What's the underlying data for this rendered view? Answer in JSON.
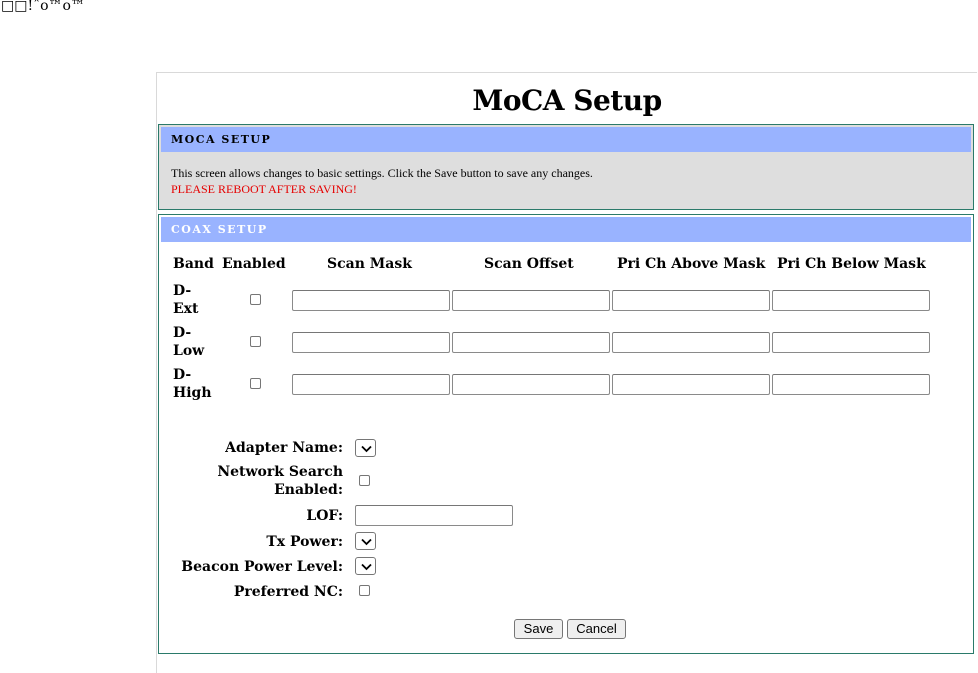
{
  "garbled_header": "□□!ˆo™o™",
  "page_title": "MoCA Setup",
  "moca_setup": {
    "header": "MOCA SETUP",
    "description": "This screen allows changes to basic settings. Click the Save button to save any changes.",
    "warning": "PLEASE REBOOT AFTER SAVING!"
  },
  "coax_setup": {
    "header": "COAX SETUP",
    "columns": [
      "Band",
      "Enabled",
      "Scan Mask",
      "Scan Offset",
      "Pri Ch Above Mask",
      "Pri Ch Below Mask"
    ],
    "rows": [
      {
        "band_line1": "D-",
        "band_line2": "Ext",
        "enabled": false,
        "scan_mask": "",
        "scan_offset": "",
        "pri_above": "",
        "pri_below": ""
      },
      {
        "band_line1": "D-",
        "band_line2": "Low",
        "enabled": false,
        "scan_mask": "",
        "scan_offset": "",
        "pri_above": "",
        "pri_below": ""
      },
      {
        "band_line1": "D-",
        "band_line2": "High",
        "enabled": false,
        "scan_mask": "",
        "scan_offset": "",
        "pri_above": "",
        "pri_below": ""
      }
    ]
  },
  "fields": {
    "adapter_name_label": "Adapter Name:",
    "adapter_name_value": "",
    "network_search_label_1": "Network Search",
    "network_search_label_2": "Enabled:",
    "network_search_checked": false,
    "lof_label": "LOF:",
    "lof_value": "",
    "tx_power_label": "Tx Power:",
    "tx_power_value": "",
    "beacon_power_label": "Beacon Power Level:",
    "beacon_power_value": "",
    "preferred_nc_label": "Preferred NC:",
    "preferred_nc_checked": false
  },
  "buttons": {
    "save": "Save",
    "cancel": "Cancel"
  },
  "icons": {
    "checkbox": "checkbox-unchecked",
    "select": "chevron-down-icon"
  }
}
